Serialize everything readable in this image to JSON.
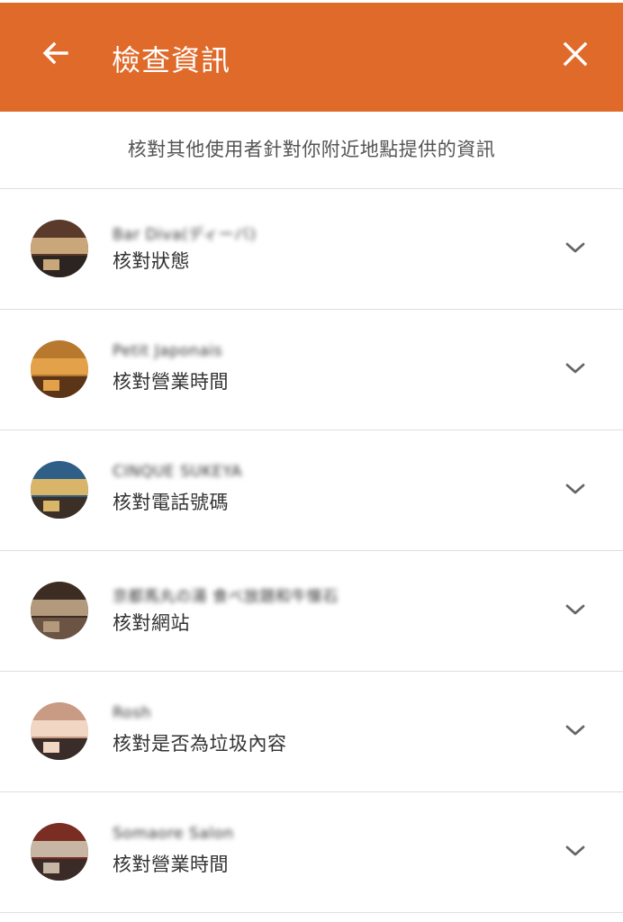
{
  "header": {
    "title": "檢查資訊",
    "back_icon": "arrow-back-icon",
    "close_icon": "close-icon",
    "color": "#df6a2a"
  },
  "subtitle": "核對其他使用者針對你附近地點提供的資訊",
  "items": [
    {
      "place_name": "Bar Diva(ディーバ)",
      "task": "核對狀態",
      "avatar_colors": [
        "#5a3a2a",
        "#c9a77a",
        "#2b2420"
      ]
    },
    {
      "place_name": "Petit Japonais",
      "task": "核對營業時間",
      "avatar_colors": [
        "#b8782e",
        "#e3a24a",
        "#5b3518"
      ]
    },
    {
      "place_name": "CINQUE SUKEYA",
      "task": "核對電話號碼",
      "avatar_colors": [
        "#2f5f86",
        "#d9b56a",
        "#3c2f25"
      ]
    },
    {
      "place_name": "京都馬丸の湯 食べ放題和牛懐石",
      "task": "核對網站",
      "avatar_colors": [
        "#3d2c22",
        "#b49a7c",
        "#6b5444"
      ]
    },
    {
      "place_name": "Rosh",
      "task": "核對是否為垃圾內容",
      "avatar_colors": [
        "#c99a84",
        "#f1d6c4",
        "#3a2c28"
      ]
    },
    {
      "place_name": "Somaore Salon",
      "task": "核對營業時間",
      "avatar_colors": [
        "#7a2d22",
        "#c7b6a3",
        "#3a2a28"
      ]
    }
  ]
}
